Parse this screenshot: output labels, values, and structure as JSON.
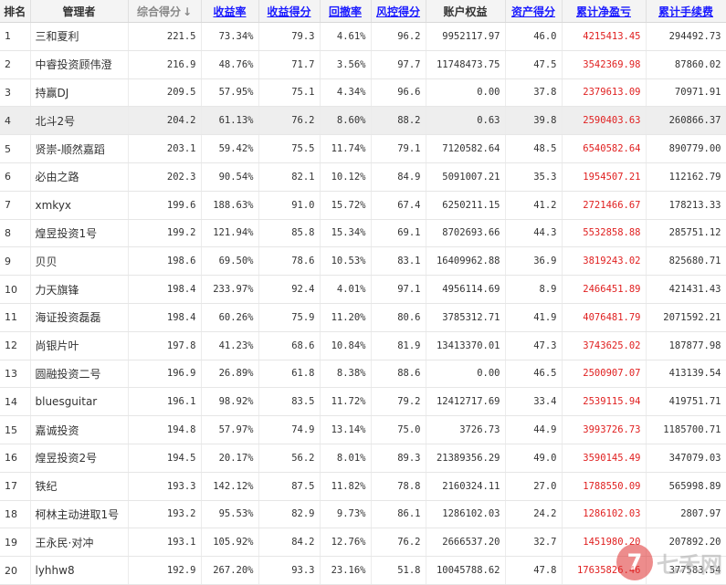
{
  "columns": [
    {
      "key": "rank",
      "label": "排名",
      "style": "plain"
    },
    {
      "key": "manager",
      "label": "管理者",
      "style": "plain"
    },
    {
      "key": "score",
      "label": "综合得分",
      "style": "sorted"
    },
    {
      "key": "return_rate",
      "label": "收益率",
      "style": "link"
    },
    {
      "key": "return_score",
      "label": "收益得分",
      "style": "link"
    },
    {
      "key": "drawdown",
      "label": "回撤率",
      "style": "link"
    },
    {
      "key": "risk_score",
      "label": "风控得分",
      "style": "link"
    },
    {
      "key": "equity",
      "label": "账户权益",
      "style": "plain"
    },
    {
      "key": "asset_score",
      "label": "资产得分",
      "style": "link"
    },
    {
      "key": "net_pnl",
      "label": "累计净盈亏",
      "style": "link"
    },
    {
      "key": "fees",
      "label": "累计手续费",
      "style": "link"
    }
  ],
  "sort_arrow": "↓",
  "highlighted_row": 3,
  "rows": [
    [
      "1",
      "三和夏利",
      "221.5",
      "73.34%",
      "79.3",
      "4.61%",
      "96.2",
      "9952117.97",
      "46.0",
      "4215413.45",
      "294492.73"
    ],
    [
      "2",
      "中睿投资顾伟澄",
      "216.9",
      "48.76%",
      "71.7",
      "3.56%",
      "97.7",
      "11748473.75",
      "47.5",
      "3542369.98",
      "87860.02"
    ],
    [
      "3",
      "持赢DJ",
      "209.5",
      "57.95%",
      "75.1",
      "4.34%",
      "96.6",
      "0.00",
      "37.8",
      "2379613.09",
      "70971.91"
    ],
    [
      "4",
      "北斗2号",
      "204.2",
      "61.13%",
      "76.2",
      "8.60%",
      "88.2",
      "0.63",
      "39.8",
      "2590403.63",
      "260866.37"
    ],
    [
      "5",
      "贤崇-顺然嘉蹈",
      "203.1",
      "59.42%",
      "75.5",
      "11.74%",
      "79.1",
      "7120582.64",
      "48.5",
      "6540582.64",
      "890779.00"
    ],
    [
      "6",
      "必由之路",
      "202.3",
      "90.54%",
      "82.1",
      "10.12%",
      "84.9",
      "5091007.21",
      "35.3",
      "1954507.21",
      "112162.79"
    ],
    [
      "7",
      "xmkyx",
      "199.6",
      "188.63%",
      "91.0",
      "15.72%",
      "67.4",
      "6250211.15",
      "41.2",
      "2721466.67",
      "178213.33"
    ],
    [
      "8",
      "煌昱投资1号",
      "199.2",
      "121.94%",
      "85.8",
      "15.34%",
      "69.1",
      "8702693.66",
      "44.3",
      "5532858.88",
      "285751.12"
    ],
    [
      "9",
      "贝贝",
      "198.6",
      "69.50%",
      "78.6",
      "10.53%",
      "83.1",
      "16409962.88",
      "36.9",
      "3819243.02",
      "825680.71"
    ],
    [
      "10",
      "力天旗锋",
      "198.4",
      "233.97%",
      "92.4",
      "4.01%",
      "97.1",
      "4956114.69",
      "8.9",
      "2466451.89",
      "421431.43"
    ],
    [
      "11",
      "海证投资磊磊",
      "198.4",
      "60.26%",
      "75.9",
      "11.20%",
      "80.6",
      "3785312.71",
      "41.9",
      "4076481.79",
      "2071592.21"
    ],
    [
      "12",
      "尚银片叶",
      "197.8",
      "41.23%",
      "68.6",
      "10.84%",
      "81.9",
      "13413370.01",
      "47.3",
      "3743625.02",
      "187877.98"
    ],
    [
      "13",
      "圆融投资二号",
      "196.9",
      "26.89%",
      "61.8",
      "8.38%",
      "88.6",
      "0.00",
      "46.5",
      "2500907.07",
      "413139.54"
    ],
    [
      "14",
      "bluesguitar",
      "196.1",
      "98.92%",
      "83.5",
      "11.72%",
      "79.2",
      "12412717.69",
      "33.4",
      "2539115.94",
      "419751.71"
    ],
    [
      "15",
      "嘉诚投资",
      "194.8",
      "57.97%",
      "74.9",
      "13.14%",
      "75.0",
      "3726.73",
      "44.9",
      "3993726.73",
      "1185700.71"
    ],
    [
      "16",
      "煌昱投资2号",
      "194.5",
      "20.17%",
      "56.2",
      "8.01%",
      "89.3",
      "21389356.29",
      "49.0",
      "3590145.49",
      "347079.03"
    ],
    [
      "17",
      "铁纪",
      "193.3",
      "142.12%",
      "87.5",
      "11.82%",
      "78.8",
      "2160324.11",
      "27.0",
      "1788550.09",
      "565998.89"
    ],
    [
      "18",
      "柯林主动进取1号",
      "193.2",
      "95.53%",
      "82.9",
      "9.73%",
      "86.1",
      "1286102.03",
      "24.2",
      "1286102.03",
      "2807.97"
    ],
    [
      "19",
      "王永民·对冲",
      "193.1",
      "105.92%",
      "84.2",
      "12.76%",
      "76.2",
      "2666537.20",
      "32.7",
      "1451980.20",
      "207892.20"
    ],
    [
      "20",
      "lyhhw8",
      "192.9",
      "267.20%",
      "93.3",
      "23.16%",
      "51.8",
      "10045788.62",
      "47.8",
      "17635826.46",
      "377583.54"
    ]
  ],
  "watermark": {
    "logo_char": "7",
    "text": "七禾网"
  },
  "colors": {
    "link": "#1a1aff",
    "pnl_red": "#e02020",
    "highlight_row": "#eeeeee",
    "header_bg": "#f4f4f4"
  }
}
